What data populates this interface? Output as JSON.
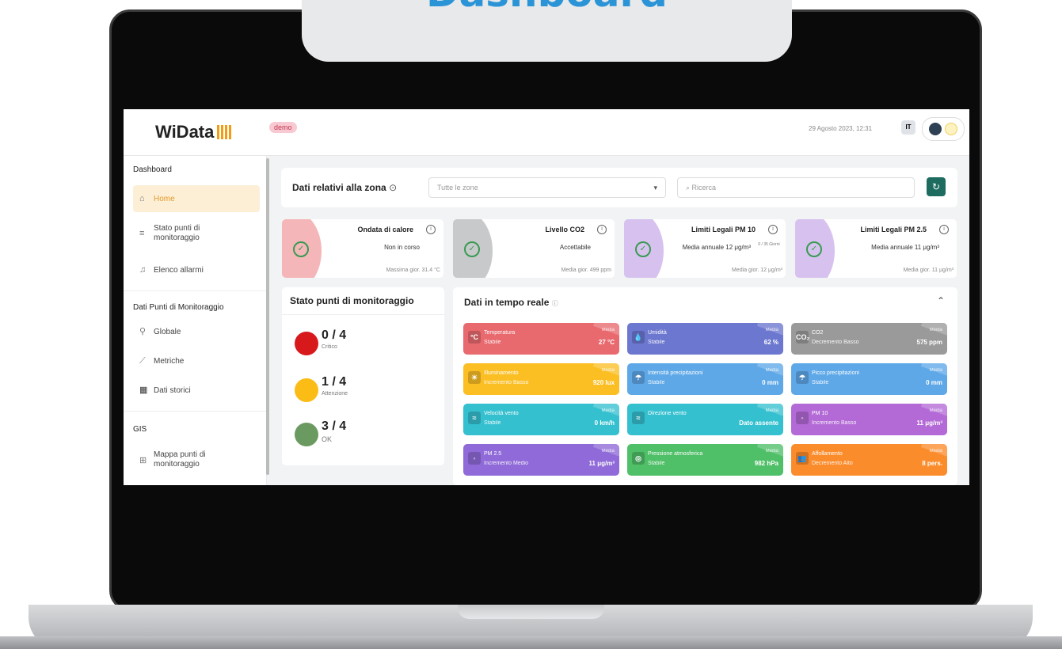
{
  "banner_title": "Dashboard",
  "topbar": {
    "logo": "WiData",
    "demo_badge": "demo",
    "datetime": "29 Agosto 2023, 12:31",
    "lang": "IT"
  },
  "sidebar": {
    "sections": [
      "Dashboard",
      "Dati Punti di Monitoraggio",
      "GIS"
    ],
    "items": [
      {
        "label": "Home",
        "icon": "home-icon"
      },
      {
        "label": "Stato punti di monitoraggio",
        "icon": "status-icon"
      },
      {
        "label": "Elenco allarmi",
        "icon": "bell-icon"
      },
      {
        "label": "Globale",
        "icon": "global-icon"
      },
      {
        "label": "Metriche",
        "icon": "chart-icon"
      },
      {
        "label": "Dati storici",
        "icon": "calendar-icon"
      },
      {
        "label": "Mappa punti di monitoraggio",
        "icon": "map-icon"
      }
    ]
  },
  "zone": {
    "label": "Dati relativi alla zona",
    "select_value": "Tutte le zone",
    "search_placeholder": "Ricerca"
  },
  "kpis": [
    {
      "title": "Ondata di calore",
      "value": "Non in corso",
      "footer": "Massima gior. 31.4 °C",
      "color": "#f4b6b8"
    },
    {
      "title": "Livello CO2",
      "value": "Accettabile",
      "footer": "Media gior. 499 ppm",
      "color": "#c8c9cb"
    },
    {
      "title": "Limiti Legali PM 10",
      "value": "Media annuale 12 μg/m³",
      "extra": "0 / 35 Giorni",
      "footer": "Media gior. 12 μg/m³",
      "color": "#d7c2ef"
    },
    {
      "title": "Limiti Legali PM 2.5",
      "value": "Media annuale 11 μg/m³",
      "footer": "Media gior. 11 μg/m³",
      "color": "#d7c2ef"
    }
  ],
  "stato": {
    "title": "Stato punti di monitoraggio",
    "rows": [
      {
        "count": "0 / 4",
        "label": "Critico",
        "color": "#d7191c"
      },
      {
        "count": "1 / 4",
        "label": "Attenzione",
        "color": "#fbbc16"
      },
      {
        "count": "3 / 4",
        "label": "OK",
        "color": "#6b9a61"
      }
    ]
  },
  "realtime": {
    "title": "Dati in tempo reale",
    "media_label": "Media",
    "tiles": [
      {
        "name": "Temperatura",
        "status": "Stabile",
        "value": "27 °C",
        "color": "#e8696e",
        "icon": "°C"
      },
      {
        "name": "Umidità",
        "status": "Stabile",
        "value": "62 %",
        "color": "#6c77cf",
        "icon": "💧"
      },
      {
        "name": "CO2",
        "status": "Decremento Basso",
        "value": "575 ppm",
        "color": "#9a9a9a",
        "icon": "CO₂"
      },
      {
        "name": "Illuminamento",
        "status": "Incremento Basso",
        "value": "920 lux",
        "color": "#fbbf24",
        "icon": "☀"
      },
      {
        "name": "Intensità precipitazioni",
        "status": "Stabile",
        "value": "0 mm",
        "color": "#5ea8e8",
        "icon": "☂"
      },
      {
        "name": "Picco precipitazioni",
        "status": "Stabile",
        "value": "0 mm",
        "color": "#5ea8e8",
        "icon": "☂"
      },
      {
        "name": "Velocità vento",
        "status": "Stabile",
        "value": "0 km/h",
        "color": "#35c0d0",
        "icon": "≈"
      },
      {
        "name": "Direzione vento",
        "status": "",
        "value": "Dato assente",
        "color": "#35c0d0",
        "icon": "≈"
      },
      {
        "name": "PM 10",
        "status": "Incremento Basso",
        "value": "11 μg/m³",
        "color": "#b36ad6",
        "icon": "◦"
      },
      {
        "name": "PM 2.5",
        "status": "Incremento Medio",
        "value": "11 μg/m³",
        "color": "#8f6ad8",
        "icon": "◦"
      },
      {
        "name": "Pressione atmosferica",
        "status": "Stabile",
        "value": "982 hPa",
        "color": "#4fbf68",
        "icon": "◎"
      },
      {
        "name": "Affollamento",
        "status": "Decremento Alto",
        "value": "8 pers.",
        "color": "#fb8c2c",
        "icon": "👥"
      }
    ]
  }
}
